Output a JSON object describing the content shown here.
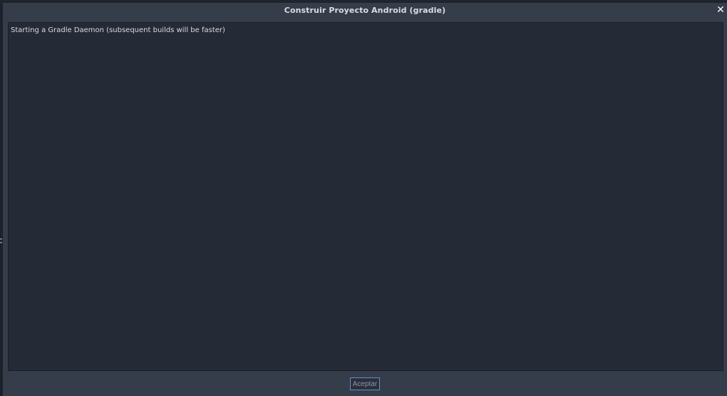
{
  "dialog": {
    "title": "Construir Proyecto Android (gradle)",
    "close_icon": "close-icon",
    "close_glyph": "✕"
  },
  "log": {
    "lines": [
      "Starting a Gradle Daemon (subsequent builds will be faster)"
    ]
  },
  "footer": {
    "accept_label": "Aceptar"
  },
  "colors": {
    "dialog_bg": "#363d4a",
    "panel_bg": "#252a37",
    "accent_border": "#6a8dc0"
  }
}
